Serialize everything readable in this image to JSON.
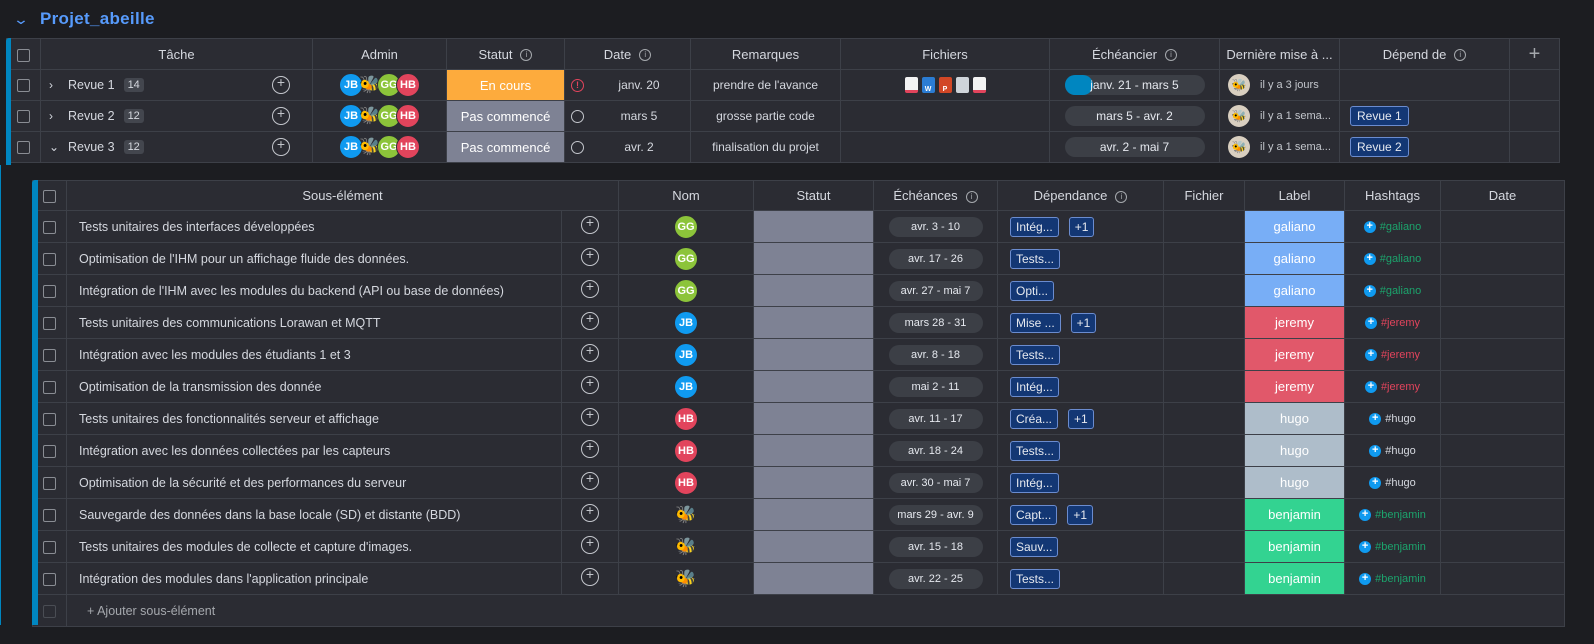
{
  "group": {
    "title": "Projet_abeille"
  },
  "main": {
    "columns": [
      "Tâche",
      "Admin",
      "Statut",
      "Date",
      "Remarques",
      "Fichiers",
      "Échéancier",
      "Dernière mise à ...",
      "Dépend de"
    ],
    "rows": [
      {
        "name": "Revue 1",
        "count": "14",
        "admins": [
          "JB",
          "bee",
          "GG",
          "HB"
        ],
        "status": "En cours",
        "status_color": "#fdab3d",
        "date": "janv. 20",
        "date_flag": "alert",
        "remarks": "prendre de l'avance",
        "files": [
          "pdf",
          "word",
          "ppt",
          "img",
          "pdf"
        ],
        "timeline": "janv. 21 - mars 5",
        "timeline_progress": 0.2,
        "last_update": "il y a 3 jours",
        "depends": ""
      },
      {
        "name": "Revue 2",
        "count": "12",
        "admins": [
          "JB",
          "bee",
          "GG",
          "HB"
        ],
        "status": "Pas commencé",
        "status_color": "#7e8294",
        "date": "mars 5",
        "date_flag": "circle",
        "remarks": "grosse partie code",
        "files": [],
        "timeline": "mars 5 - avr. 2",
        "timeline_progress": 0,
        "last_update": "il y a 1 sema...",
        "depends": "Revue 1"
      },
      {
        "name": "Revue 3",
        "count": "12",
        "admins": [
          "JB",
          "bee",
          "GG",
          "HB"
        ],
        "status": "Pas commencé",
        "status_color": "#7e8294",
        "date": "avr. 2",
        "date_flag": "circle",
        "remarks": "finalisation du projet",
        "files": [],
        "timeline": "avr. 2 - mai 7",
        "timeline_progress": 0,
        "last_update": "il y a 1 sema...",
        "depends": "Revue 2"
      }
    ]
  },
  "sub": {
    "columns": [
      "Sous-élément",
      "Nom",
      "Statut",
      "Échéances",
      "Dépendance",
      "Fichier",
      "Label",
      "Hashtags",
      "Date"
    ],
    "rows": [
      {
        "name": "Tests unitaires des interfaces développées",
        "owner": "GG",
        "deadline": "avr. 3 - 10",
        "dep": "Intég...",
        "dep_more": "+1",
        "label": "galiano",
        "label_color": "#78aef6",
        "hashtag": "#galiano",
        "hash_color": "#1ca36c"
      },
      {
        "name": "Optimisation de l'IHM pour un affichage fluide des données.",
        "owner": "GG",
        "deadline": "avr. 17 - 26",
        "dep": "Tests...",
        "dep_more": "",
        "label": "galiano",
        "label_color": "#78aef6",
        "hashtag": "#galiano",
        "hash_color": "#1ca36c"
      },
      {
        "name": "Intégration de l'IHM avec les modules du backend (API ou base de données)",
        "owner": "GG",
        "deadline": "avr. 27 - mai 7",
        "dep": "Opti...",
        "dep_more": "",
        "label": "galiano",
        "label_color": "#78aef6",
        "hashtag": "#galiano",
        "hash_color": "#1ca36c"
      },
      {
        "name": "Tests unitaires des communications Lorawan et MQTT",
        "owner": "JB",
        "deadline": "mars 28 - 31",
        "dep": "Mise ...",
        "dep_more": "+1",
        "label": "jeremy",
        "label_color": "#e1586a",
        "hashtag": "#jeremy",
        "hash_color": "#e2445c"
      },
      {
        "name": "Intégration avec les modules des étudiants 1 et 3",
        "owner": "JB",
        "deadline": "avr. 8 - 18",
        "dep": "Tests...",
        "dep_more": "",
        "label": "jeremy",
        "label_color": "#e1586a",
        "hashtag": "#jeremy",
        "hash_color": "#e2445c"
      },
      {
        "name": "Optimisation de la transmission des donnée",
        "owner": "JB",
        "deadline": "mai 2 - 11",
        "dep": "Intég...",
        "dep_more": "",
        "label": "jeremy",
        "label_color": "#e1586a",
        "hashtag": "#jeremy",
        "hash_color": "#e2445c"
      },
      {
        "name": "Tests unitaires des fonctionnalités serveur et affichage",
        "owner": "HB",
        "deadline": "avr. 11 - 17",
        "dep": "Créa...",
        "dep_more": "+1",
        "label": "hugo",
        "label_color": "#aebdca",
        "hashtag": "#hugo",
        "hash_color": "#d5d8df"
      },
      {
        "name": "Intégration avec les données collectées par les capteurs",
        "owner": "HB",
        "deadline": "avr. 18 - 24",
        "dep": "Tests...",
        "dep_more": "",
        "label": "hugo",
        "label_color": "#aebdca",
        "hashtag": "#hugo",
        "hash_color": "#d5d8df"
      },
      {
        "name": "Optimisation de la sécurité et des performances du serveur",
        "owner": "HB",
        "deadline": "avr. 30 - mai 7",
        "dep": "Intég...",
        "dep_more": "",
        "label": "hugo",
        "label_color": "#aebdca",
        "hashtag": "#hugo",
        "hash_color": "#d5d8df"
      },
      {
        "name": "Sauvegarde des données dans la base locale (SD) et distante (BDD)",
        "owner": "bee",
        "deadline": "mars 29 - avr. 9",
        "dep": "Capt...",
        "dep_more": "+1",
        "label": "benjamin",
        "label_color": "#33d391",
        "hashtag": "#benjamin",
        "hash_color": "#1ca36c"
      },
      {
        "name": "Tests unitaires des modules de collecte et capture d'images.",
        "owner": "bee",
        "deadline": "avr. 15 - 18",
        "dep": "Sauv...",
        "dep_more": "",
        "label": "benjamin",
        "label_color": "#33d391",
        "hashtag": "#benjamin",
        "hash_color": "#1ca36c"
      },
      {
        "name": "Intégration des modules dans l'application principale",
        "owner": "bee",
        "deadline": "avr. 22 - 25",
        "dep": "Tests...",
        "dep_more": "",
        "label": "benjamin",
        "label_color": "#33d391",
        "hashtag": "#benjamin",
        "hash_color": "#1ca36c"
      }
    ],
    "add_label": "+ Ajouter sous-élément"
  }
}
